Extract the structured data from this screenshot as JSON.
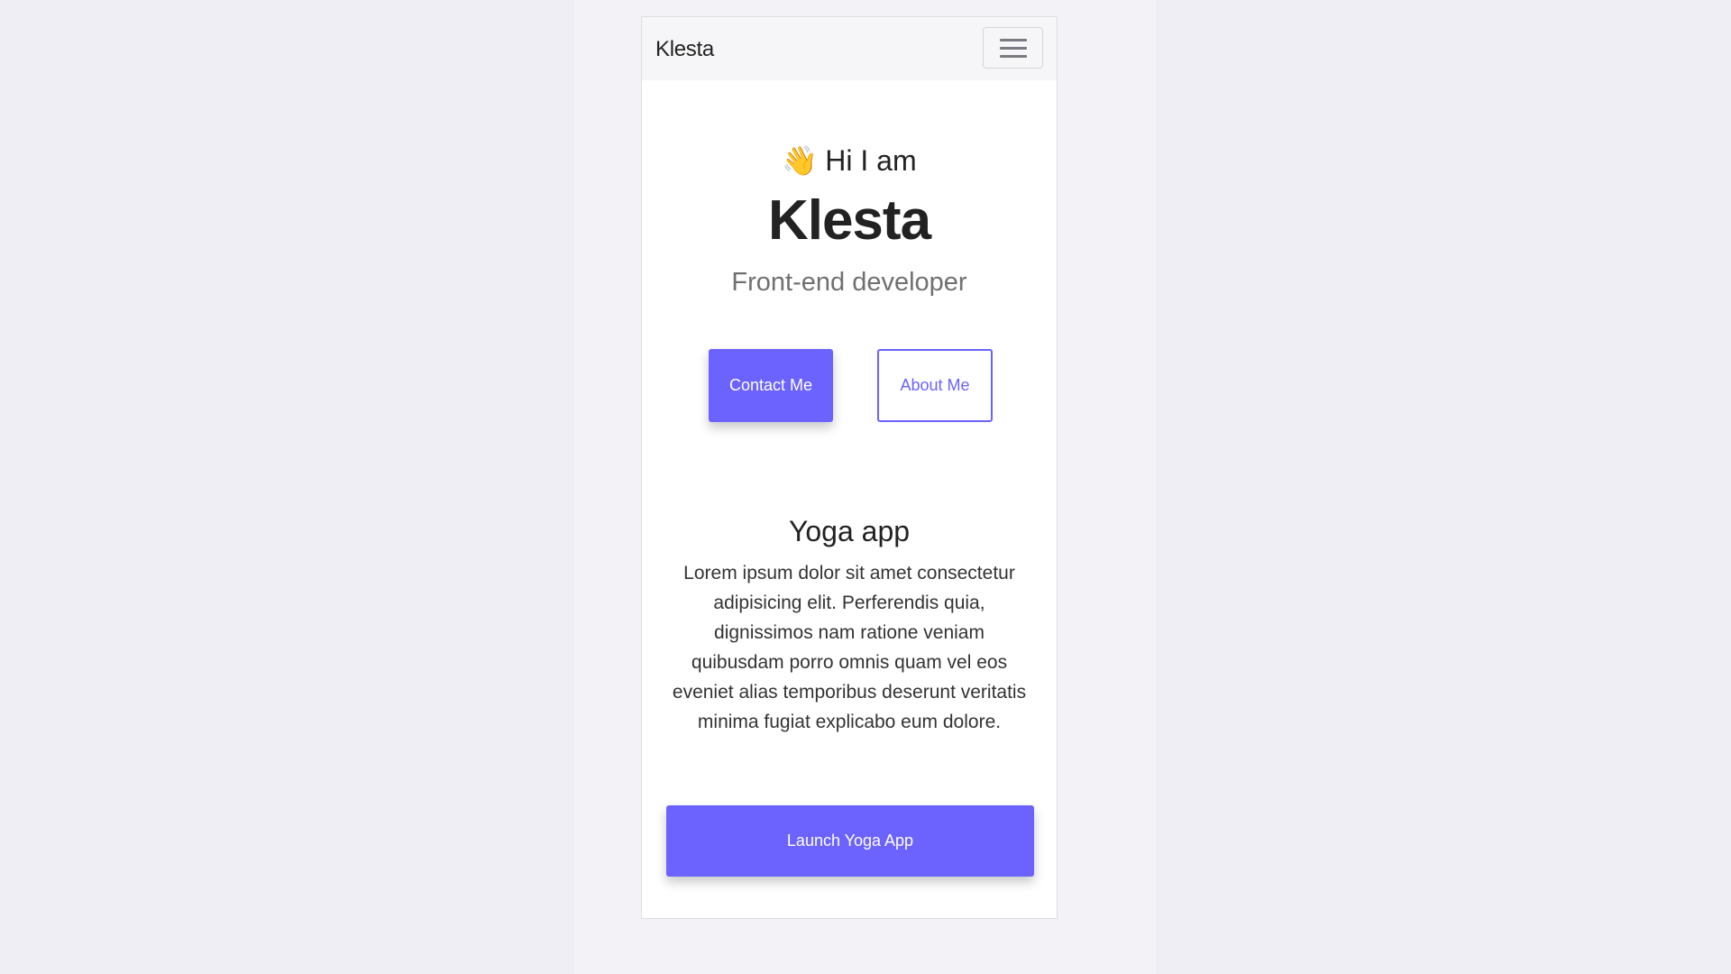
{
  "navbar": {
    "brand": "Klesta",
    "menu_icon": "hamburger-icon"
  },
  "hero": {
    "emoji": "👋",
    "greeting": "Hi I am",
    "name": "Klesta",
    "role": "Front-end developer"
  },
  "actions": {
    "contact_label": "Contact Me",
    "about_label": "About Me"
  },
  "project": {
    "title": "Yoga app",
    "description": "Lorem ipsum dolor sit amet consectetur adipisicing elit. Perferendis quia, dignissimos nam ratione veniam quibusdam porro omnis quam vel eos eveniet alias temporibus deserunt veritatis minima fugiat explicabo eum dolore.",
    "launch_label": "Launch Yoga App"
  },
  "colors": {
    "accent": "#6c63ff",
    "background": "#eeeef4",
    "card": "#ffffff"
  }
}
